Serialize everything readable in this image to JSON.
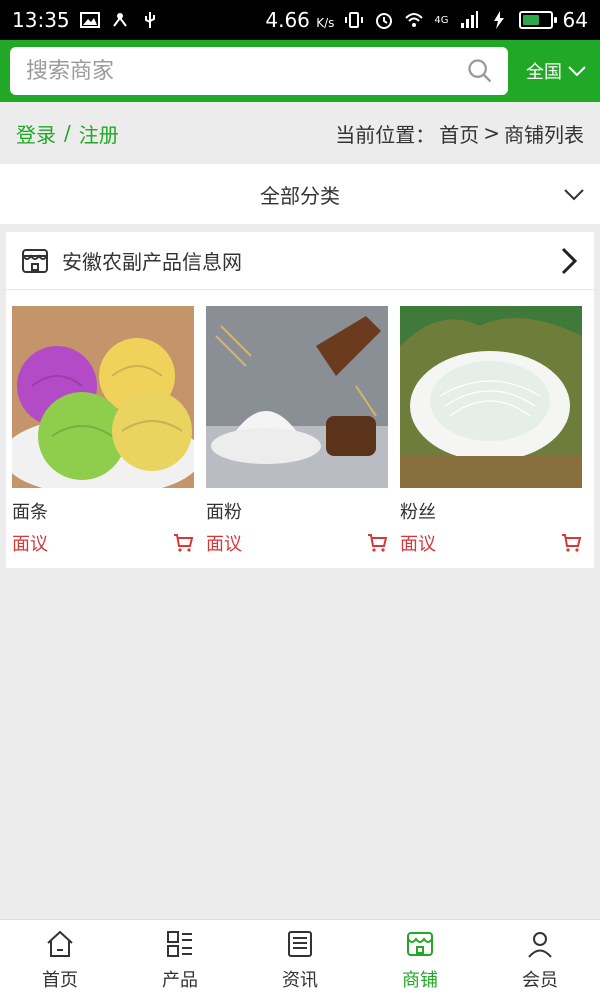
{
  "status_bar": {
    "time": "13:35",
    "speed": "4.66",
    "speed_unit": "K/s",
    "network": "4G",
    "battery_level": "64",
    "battery_fraction": 0.64
  },
  "header": {
    "search_placeholder": "搜索商家",
    "region_label": "全国"
  },
  "crumbbar": {
    "login": "登录",
    "separator": "/",
    "register": "注册",
    "location_label": "当前位置：",
    "home": "首页",
    "arrow": ">",
    "current": "商铺列表"
  },
  "filter": {
    "label": "全部分类"
  },
  "shop": {
    "name": "安徽农副产品信息网",
    "products": [
      {
        "name": "面条",
        "price": "面议"
      },
      {
        "name": "面粉",
        "price": "面议"
      },
      {
        "name": "粉丝",
        "price": "面议"
      }
    ]
  },
  "bottom_nav": {
    "items": [
      {
        "label": "首页",
        "icon": "home-icon"
      },
      {
        "label": "产品",
        "icon": "grid-icon"
      },
      {
        "label": "资讯",
        "icon": "news-icon"
      },
      {
        "label": "商铺",
        "icon": "store-icon",
        "active": true
      },
      {
        "label": "会员",
        "icon": "user-icon"
      }
    ]
  },
  "colors": {
    "brand": "#20a826",
    "price": "#d6383a",
    "page_bg": "#ececec"
  }
}
